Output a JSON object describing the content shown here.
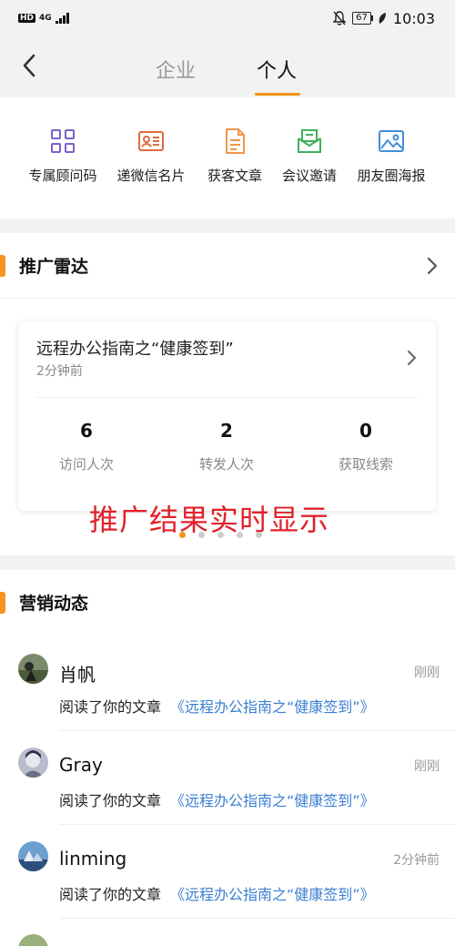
{
  "status_bar": {
    "network": "4G",
    "hd": "HD",
    "battery": "67",
    "time": "10:03"
  },
  "nav": {
    "tabs": [
      {
        "label": "企业"
      },
      {
        "label": "个人"
      }
    ],
    "active_tab": "个人"
  },
  "tools": [
    {
      "label": "专属顾问码",
      "icon": "qr-code-icon",
      "color": "#7b62c7"
    },
    {
      "label": "递微信名片",
      "icon": "business-card-icon",
      "color": "#e06a3b"
    },
    {
      "label": "获客文章",
      "icon": "document-icon",
      "color": "#f0954a"
    },
    {
      "label": "会议邀请",
      "icon": "invitation-envelope-icon",
      "color": "#3fb05a"
    },
    {
      "label": "朋友圈海报",
      "icon": "poster-image-icon",
      "color": "#3f8fd8"
    }
  ],
  "radar": {
    "title": "推广雷达",
    "card": {
      "title": "远程办公指南之“健康签到”",
      "time": "2分钟前",
      "stats": [
        {
          "value": "6",
          "label": "访问人次"
        },
        {
          "value": "2",
          "label": "转发人次"
        },
        {
          "value": "0",
          "label": "获取线索"
        }
      ]
    },
    "overlay_text": "推广结果实时显示",
    "carousel_active_index": 0
  },
  "marketing": {
    "title": "营销动态",
    "items": [
      {
        "name": "肖帆",
        "time": "刚刚",
        "action": "阅读了你的文章",
        "article": "《远程办公指南之“健康签到”》"
      },
      {
        "name": "Gray",
        "time": "刚刚",
        "action": "阅读了你的文章",
        "article": "《远程办公指南之“健康签到”》"
      },
      {
        "name": "linming",
        "time": "2分钟前",
        "action": "阅读了你的文章",
        "article": "《远程办公指南之“健康签到”》"
      }
    ]
  },
  "colors": {
    "accent": "#f7931e",
    "link": "#3b7fd1",
    "overlay": "#e0222a"
  }
}
